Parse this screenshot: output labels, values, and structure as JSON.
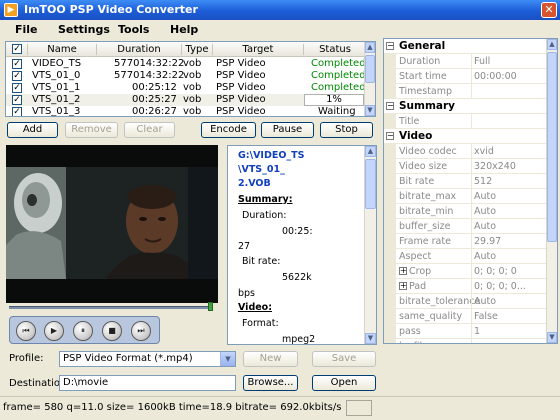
{
  "window": {
    "title": "ImTOO PSP Video Converter"
  },
  "menu": [
    "File",
    "Settings",
    "Tools",
    "Help"
  ],
  "table": {
    "columns": [
      "Name",
      "Duration",
      "Type",
      "Target",
      "Status"
    ],
    "rows": [
      {
        "checked": true,
        "name": "VIDEO_TS",
        "duration": "577014:32:22",
        "type": "vob",
        "target": "PSP Video",
        "status": "Completed"
      },
      {
        "checked": true,
        "name": "VTS_01_0",
        "duration": "577014:32:22",
        "type": "vob",
        "target": "PSP Video",
        "status": "Completed"
      },
      {
        "checked": true,
        "name": "VTS_01_1",
        "duration": "00:25:12",
        "type": "vob",
        "target": "PSP Video",
        "status": "Completed"
      },
      {
        "checked": true,
        "name": "VTS_01_2",
        "duration": "00:25:27",
        "type": "vob",
        "target": "PSP Video",
        "status": "1%",
        "progress": 0.01
      },
      {
        "checked": true,
        "name": "VTS_01_3",
        "duration": "00:26:27",
        "type": "vob",
        "target": "PSP Video",
        "status": "Waiting"
      }
    ]
  },
  "actions": {
    "add": "Add",
    "remove": "Remove",
    "clear": "Clear",
    "encode": "Encode",
    "pause": "Pause",
    "stop": "Stop"
  },
  "player": {
    "seek_position": 0.99
  },
  "info": {
    "path1": "G:\\VIDEO_TS",
    "path2": "\\VTS_01_",
    "path3": "2.VOB",
    "summary": "Summary:",
    "duration_label": "Duration:",
    "duration_val1": "00:25:",
    "duration_val2": "27",
    "bitrate_label": "Bit rate:",
    "bitrate_val": "5622k",
    "bitrate_unit": "bps",
    "video": "Video:",
    "format_label": "Format:",
    "format_val": "mpeg2"
  },
  "profile": {
    "label": "Profile:",
    "value": "PSP Video Format  (*.mp4)",
    "new": "New",
    "save": "Save"
  },
  "destination": {
    "label": "Destination:",
    "value": "D:\\movie",
    "browse": "Browse...",
    "open": "Open"
  },
  "properties": {
    "general": "General",
    "duration": [
      "Duration",
      "Full"
    ],
    "start_time": [
      "Start time",
      "00:00:00"
    ],
    "timestamp": [
      "Timestamp",
      ""
    ],
    "summary": "Summary",
    "title": [
      "Title",
      ""
    ],
    "video": "Video",
    "video_codec": [
      "Video codec",
      "xvid"
    ],
    "video_size": [
      "Video size",
      "320x240"
    ],
    "bit_rate": [
      "Bit rate",
      "512"
    ],
    "bitrate_max": [
      "bitrate_max",
      "Auto"
    ],
    "bitrate_min": [
      "bitrate_min",
      "Auto"
    ],
    "buffer_size": [
      "buffer_size",
      "Auto"
    ],
    "frame_rate": [
      "Frame rate",
      "29.97"
    ],
    "aspect": [
      "Aspect",
      "Auto"
    ],
    "crop": [
      "Crop",
      "0; 0; 0; 0"
    ],
    "pad": [
      "Pad",
      "0; 0; 0; 0..."
    ],
    "bitrate_tolerance": [
      "bitrate_tolerance",
      "Auto"
    ],
    "same_quality": [
      "same_quality",
      "False"
    ],
    "pass": [
      "pass",
      "1"
    ],
    "logfilename": [
      "logfilename",
      ""
    ]
  },
  "status": {
    "text": "frame=  580 q=11.0 size=    1600kB time=18.9 bitrate= 692.0kbits/s"
  }
}
